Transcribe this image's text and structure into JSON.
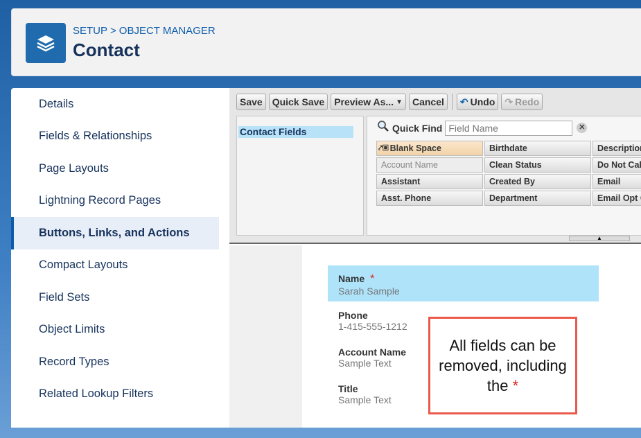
{
  "header": {
    "breadcrumb": {
      "setup": "SETUP",
      "separator": ">",
      "object_manager": "OBJECT MANAGER"
    },
    "title": "Contact"
  },
  "sidebar": {
    "items": [
      {
        "label": "Details"
      },
      {
        "label": "Fields & Relationships"
      },
      {
        "label": "Page Layouts"
      },
      {
        "label": "Lightning Record Pages"
      },
      {
        "label": "Buttons, Links, and Actions",
        "active": true
      },
      {
        "label": "Compact Layouts"
      },
      {
        "label": "Field Sets"
      },
      {
        "label": "Object Limits"
      },
      {
        "label": "Record Types"
      },
      {
        "label": "Related Lookup Filters"
      }
    ]
  },
  "toolbar": {
    "save": "Save",
    "quick_save": "Quick Save",
    "preview_as": "Preview As...",
    "cancel": "Cancel",
    "undo": "Undo",
    "redo": "Redo"
  },
  "palette": {
    "category": "Contact Fields",
    "quick_find_label": "Quick Find",
    "quick_find_placeholder": "Field Name",
    "fields": [
      {
        "label": "Blank Space",
        "state": "blank"
      },
      {
        "label": "Birthdate",
        "state": "available"
      },
      {
        "label": "Description",
        "state": "available"
      },
      {
        "label": "Account Name",
        "state": "used"
      },
      {
        "label": "Clean Status",
        "state": "available"
      },
      {
        "label": "Do Not Call",
        "state": "available"
      },
      {
        "label": "Assistant",
        "state": "available"
      },
      {
        "label": "Created By",
        "state": "available"
      },
      {
        "label": "Email",
        "state": "available"
      },
      {
        "label": "Asst. Phone",
        "state": "available"
      },
      {
        "label": "Department",
        "state": "available"
      },
      {
        "label": "Email Opt O",
        "state": "available"
      }
    ]
  },
  "layout_fields": [
    {
      "label": "Name",
      "value": "Sarah Sample",
      "required_mark": "*"
    },
    {
      "label": "Phone",
      "value": "1-415-555-1212"
    },
    {
      "label": "Account Name",
      "value": "Sample Text"
    },
    {
      "label": "Title",
      "value": "Sample Text"
    }
  ],
  "callout": {
    "text": "All fields can be removed, including the",
    "star": "*",
    "border_color": "#e95a4c"
  },
  "colors": {
    "accent": "#0b5cab",
    "selected_field": "#aee3fa",
    "required": "#e0201a"
  }
}
